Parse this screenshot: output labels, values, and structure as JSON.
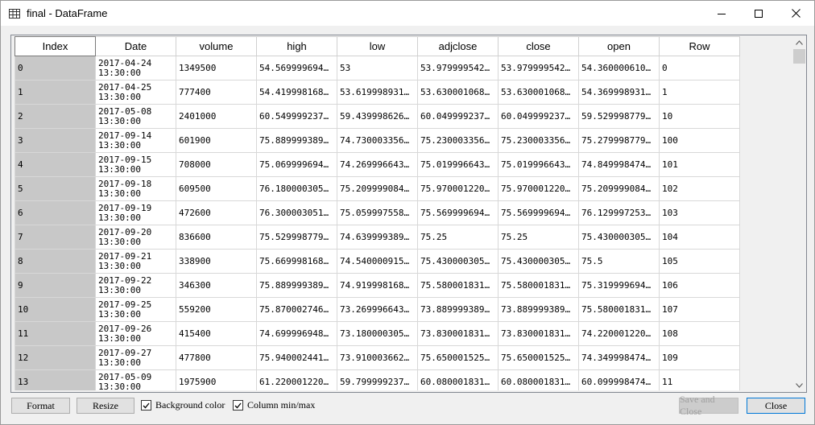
{
  "window": {
    "title": "final - DataFrame",
    "icon": "table-icon",
    "minimize_icon": "minimize-icon",
    "maximize_icon": "maximize-icon",
    "close_icon": "close-icon"
  },
  "table": {
    "columns": [
      "Index",
      "Date",
      "volume",
      "high",
      "low",
      "adjclose",
      "close",
      "open",
      "Row"
    ],
    "rows": [
      {
        "index": "0",
        "date1": "2017-04-24",
        "date2": "13:30:00",
        "volume": "1349500",
        "high": "54.569999694…",
        "low": "53",
        "adjclose": "53.979999542…",
        "close": "53.979999542…",
        "open": "54.360000610…",
        "row": "0"
      },
      {
        "index": "1",
        "date1": "2017-04-25",
        "date2": "13:30:00",
        "volume": "777400",
        "high": "54.419998168…",
        "low": "53.619998931…",
        "adjclose": "53.630001068…",
        "close": "53.630001068…",
        "open": "54.369998931…",
        "row": "1"
      },
      {
        "index": "2",
        "date1": "2017-05-08",
        "date2": "13:30:00",
        "volume": "2401000",
        "high": "60.549999237…",
        "low": "59.439998626…",
        "adjclose": "60.049999237…",
        "close": "60.049999237…",
        "open": "59.529998779…",
        "row": "10"
      },
      {
        "index": "3",
        "date1": "2017-09-14",
        "date2": "13:30:00",
        "volume": "601900",
        "high": "75.889999389…",
        "low": "74.730003356…",
        "adjclose": "75.230003356…",
        "close": "75.230003356…",
        "open": "75.279998779…",
        "row": "100"
      },
      {
        "index": "4",
        "date1": "2017-09-15",
        "date2": "13:30:00",
        "volume": "708000",
        "high": "75.069999694…",
        "low": "74.269996643…",
        "adjclose": "75.019996643…",
        "close": "75.019996643…",
        "open": "74.849998474…",
        "row": "101"
      },
      {
        "index": "5",
        "date1": "2017-09-18",
        "date2": "13:30:00",
        "volume": "609500",
        "high": "76.180000305…",
        "low": "75.209999084…",
        "adjclose": "75.970001220…",
        "close": "75.970001220…",
        "open": "75.209999084…",
        "row": "102"
      },
      {
        "index": "6",
        "date1": "2017-09-19",
        "date2": "13:30:00",
        "volume": "472600",
        "high": "76.300003051…",
        "low": "75.059997558…",
        "adjclose": "75.569999694…",
        "close": "75.569999694…",
        "open": "76.129997253…",
        "row": "103"
      },
      {
        "index": "7",
        "date1": "2017-09-20",
        "date2": "13:30:00",
        "volume": "836600",
        "high": "75.529998779…",
        "low": "74.639999389…",
        "adjclose": "75.25",
        "close": "75.25",
        "open": "75.430000305…",
        "row": "104"
      },
      {
        "index": "8",
        "date1": "2017-09-21",
        "date2": "13:30:00",
        "volume": "338900",
        "high": "75.669998168…",
        "low": "74.540000915…",
        "adjclose": "75.430000305…",
        "close": "75.430000305…",
        "open": "75.5",
        "row": "105"
      },
      {
        "index": "9",
        "date1": "2017-09-22",
        "date2": "13:30:00",
        "volume": "346300",
        "high": "75.889999389…",
        "low": "74.919998168…",
        "adjclose": "75.580001831…",
        "close": "75.580001831…",
        "open": "75.319999694…",
        "row": "106"
      },
      {
        "index": "10",
        "date1": "2017-09-25",
        "date2": "13:30:00",
        "volume": "559200",
        "high": "75.870002746…",
        "low": "73.269996643…",
        "adjclose": "73.889999389…",
        "close": "73.889999389…",
        "open": "75.580001831…",
        "row": "107"
      },
      {
        "index": "11",
        "date1": "2017-09-26",
        "date2": "13:30:00",
        "volume": "415400",
        "high": "74.699996948…",
        "low": "73.180000305…",
        "adjclose": "73.830001831…",
        "close": "73.830001831…",
        "open": "74.220001220…",
        "row": "108"
      },
      {
        "index": "12",
        "date1": "2017-09-27",
        "date2": "13:30:00",
        "volume": "477800",
        "high": "75.940002441…",
        "low": "73.910003662…",
        "adjclose": "75.650001525…",
        "close": "75.650001525…",
        "open": "74.349998474…",
        "row": "109"
      },
      {
        "index": "13",
        "date1": "2017-05-09",
        "date2": "13:30:00",
        "volume": "1975900",
        "high": "61.220001220…",
        "low": "59.799999237…",
        "adjclose": "60.080001831…",
        "close": "60.080001831…",
        "open": "60.099998474…",
        "row": "11"
      }
    ]
  },
  "scrollbar": {
    "up_icon": "scroll-up-icon",
    "down_icon": "scroll-down-icon"
  },
  "footer": {
    "format_label": "Format",
    "resize_label": "Resize",
    "background_color_label": "Background color",
    "background_color_checked": true,
    "column_minmax_label": "Column min/max",
    "column_minmax_checked": true,
    "save_close_label": "Save and Close",
    "close_label": "Close"
  }
}
